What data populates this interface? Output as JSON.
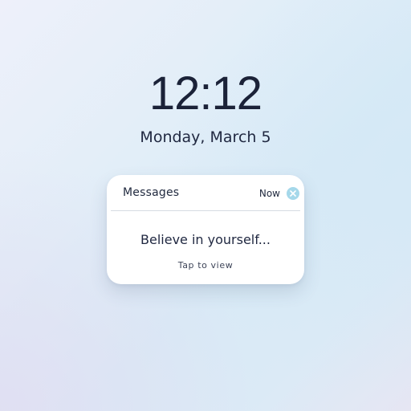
{
  "lockscreen": {
    "time": "12:12",
    "date": "Monday, March 5"
  },
  "notification": {
    "app_name": "Messages",
    "time_label": "Now",
    "message": "Believe in yourself...",
    "hint": "Tap to view",
    "close_icon": "close-icon",
    "close_color": "#a5d8ea"
  },
  "colors": {
    "text_primary": "#1b2238",
    "card_background": "#ffffff",
    "background_tint": "#d8eaf6"
  }
}
